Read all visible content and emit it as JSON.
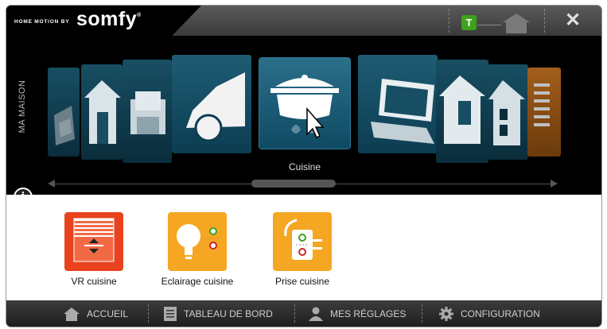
{
  "titlebar": {
    "brand_small": "HOME MOTION BY",
    "brand_logo": "somfy",
    "brand_reg": "®",
    "badge_letter": "T",
    "close_glyph": "✕"
  },
  "carousel": {
    "side_label": "MA MAISON",
    "selected_label": "Cuisine",
    "info_glyph": "i",
    "tiles": [
      "garage-icon",
      "house-icon",
      "sofa-icon",
      "car-icon",
      "pot-icon",
      "laptop-icon",
      "bedroom-icon",
      "house-window-icon",
      "blind-icon"
    ]
  },
  "devices": [
    {
      "label": "VR cuisine",
      "icon": "roller-shutter-icon",
      "color": "#e8431e"
    },
    {
      "label": "Eclairage cuisine",
      "icon": "light-bulb-icon",
      "color": "#f5a623"
    },
    {
      "label": "Prise cuisine",
      "icon": "plug-icon",
      "color": "#f5a623"
    }
  ],
  "nav": {
    "home": "ACCUEIL",
    "dashboard": "TABLEAU DE BORD",
    "settings": "MES RÉGLAGES",
    "config": "CONFIGURATION"
  },
  "colors": {
    "accent_green": "#3ea21a",
    "tile_blue": "#1e5c74",
    "shutter_red": "#e8431e",
    "lamp_yellow": "#f5a623"
  }
}
